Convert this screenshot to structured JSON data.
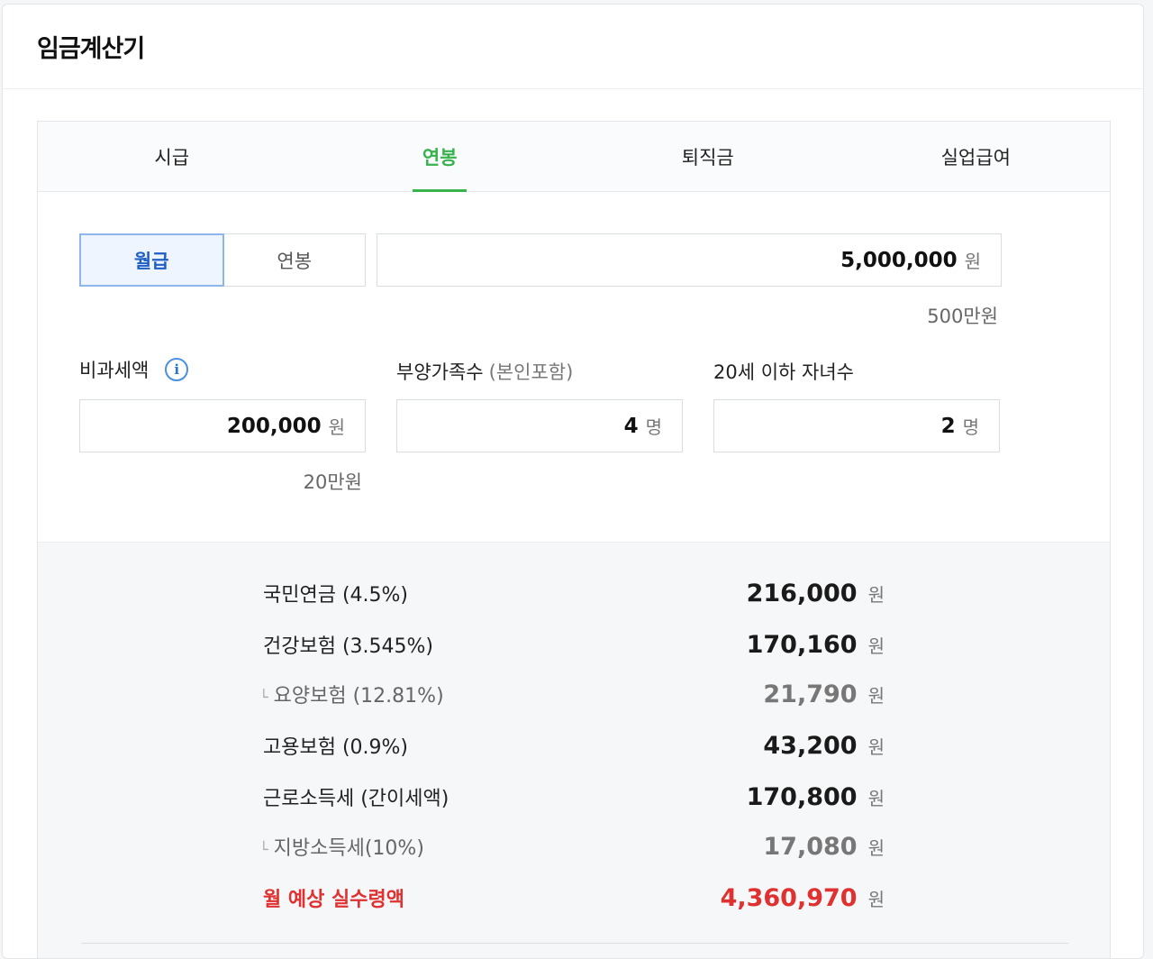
{
  "title": "임금계산기",
  "tabs": [
    {
      "label": "시급",
      "active": false
    },
    {
      "label": "연봉",
      "active": true
    },
    {
      "label": "퇴직금",
      "active": false
    },
    {
      "label": "실업급여",
      "active": false
    }
  ],
  "pay_type": {
    "options": [
      {
        "label": "월급",
        "active": true
      },
      {
        "label": "연봉",
        "active": false
      }
    ]
  },
  "salary": {
    "value": "5,000,000",
    "unit": "원",
    "helper": "500만원"
  },
  "nontaxable": {
    "label": "비과세액",
    "value": "200,000",
    "unit": "원",
    "helper": "20만원"
  },
  "dependents": {
    "label": "부양가족수",
    "sublabel": "(본인포함)",
    "value": "4",
    "unit": "명"
  },
  "children": {
    "label": "20세 이하 자녀수",
    "value": "2",
    "unit": "명"
  },
  "results": {
    "unit": "원",
    "rows": [
      {
        "label": "국민연금 (4.5%)",
        "value": "216,000",
        "sub": false
      },
      {
        "label": "건강보험 (3.545%)",
        "value": "170,160",
        "sub": false
      },
      {
        "label": "요양보험 (12.81%)",
        "value": "21,790",
        "sub": true
      },
      {
        "label": "고용보험 (0.9%)",
        "value": "43,200",
        "sub": false
      },
      {
        "label": "근로소득세 (간이세액)",
        "value": "170,800",
        "sub": false
      },
      {
        "label": "지방소득세(10%)",
        "value": "17,080",
        "sub": true
      }
    ],
    "total": {
      "label": "월 예상 실수령액",
      "value": "4,360,970"
    }
  },
  "colors": {
    "accent": "#37b24d",
    "primary": "#1f5fc4",
    "danger": "#e03131"
  },
  "icons": {
    "branch": "└",
    "info": "i"
  }
}
